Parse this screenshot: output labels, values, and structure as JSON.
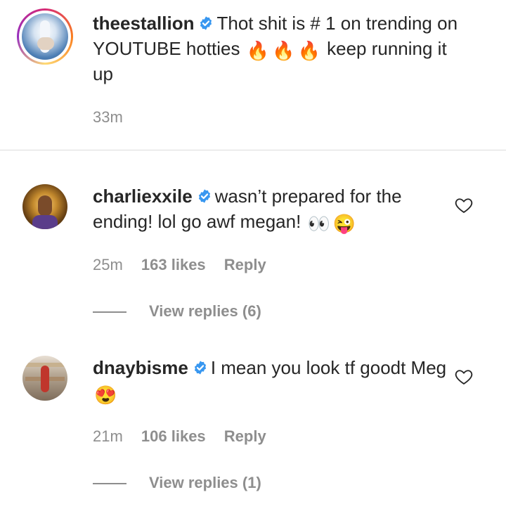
{
  "caption": {
    "username": "theestallion",
    "text_before": "Thot shit is # 1 on trending on YOUTUBE hotties",
    "emojis": [
      "🔥",
      "🔥",
      "🔥"
    ],
    "text_after": "keep running it up",
    "time": "33m"
  },
  "comments": [
    {
      "username": "charliexxile",
      "text": "wasn’t prepared for the ending! lol go awf megan!",
      "emojis": [
        "👀",
        "😜"
      ],
      "time": "25m",
      "likes": "163 likes",
      "reply_label": "Reply",
      "view_replies": "View replies (6)"
    },
    {
      "username": "dnaybisme",
      "text": "I mean you look tf goodt Meg",
      "emojis": [
        "😍"
      ],
      "time": "21m",
      "likes": "106 likes",
      "reply_label": "Reply",
      "view_replies": "View replies (1)"
    }
  ],
  "icons": {
    "verified": "verified-badge-icon",
    "heart": "heart-outline-icon"
  },
  "colors": {
    "verified_blue": "#3897f0",
    "text": "#262626",
    "secondary": "#8e8e8e",
    "divider": "#dbdbdb"
  }
}
